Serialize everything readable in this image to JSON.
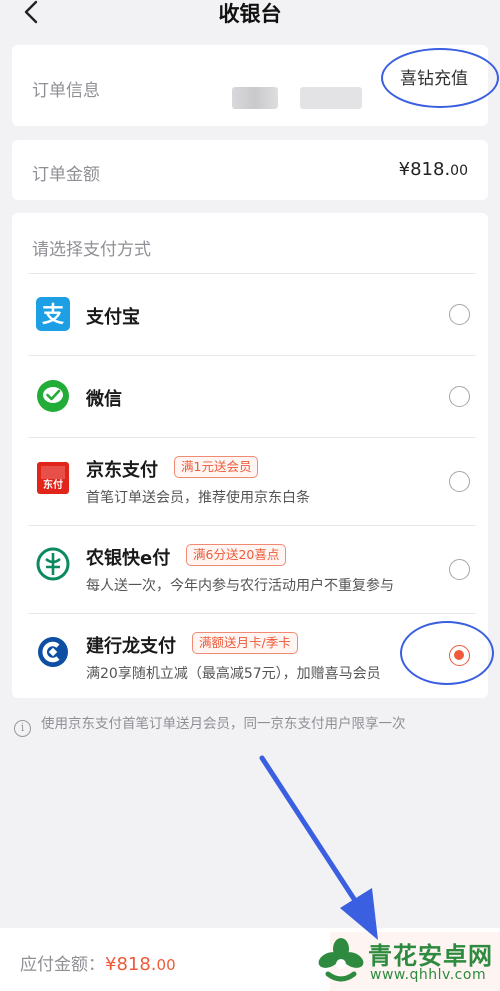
{
  "header": {
    "title": "收银台"
  },
  "order_info": {
    "label": "订单信息",
    "title": "喜钻充值"
  },
  "order_amount": {
    "label": "订单金额",
    "value_main": "¥818.",
    "value_dec": "00"
  },
  "payment": {
    "section_title": "请选择支付方式",
    "methods": [
      {
        "name": "支付宝",
        "tag": "",
        "desc": "",
        "selected": false,
        "icon": "alipay-icon"
      },
      {
        "name": "微信",
        "tag": "",
        "desc": "",
        "selected": false,
        "icon": "wechat-icon"
      },
      {
        "name": "京东支付",
        "tag": "满1元送会员",
        "desc": "首笔订单送会员，推荐使用京东白条",
        "selected": false,
        "icon": "jdpay-icon",
        "icon_text": "东付"
      },
      {
        "name": "农银快e付",
        "tag": "满6分送20喜点",
        "desc": "每人送一次，今年内参与农行活动用户不重复参与",
        "selected": false,
        "icon": "abc-bank-icon"
      },
      {
        "name": "建行龙支付",
        "tag": "满额送月卡/季卡",
        "desc": "满20享随机立减（最高减57元），加赠喜马会员",
        "selected": true,
        "icon": "ccb-bank-icon"
      }
    ]
  },
  "notice": {
    "text": "使用京东支付首笔订单送月会员，同一京东支付用户限享一次",
    "icon_glyph": "i"
  },
  "bottom": {
    "due_label": "应付金额：",
    "due_main": "¥818.",
    "due_dec": "00"
  },
  "watermark": {
    "name": "青花安卓网",
    "url": "www.qhhlv.com"
  },
  "colors": {
    "accent": "#ee5a3a",
    "annotation": "#3a5fe0",
    "background": "#f2f2f4"
  }
}
